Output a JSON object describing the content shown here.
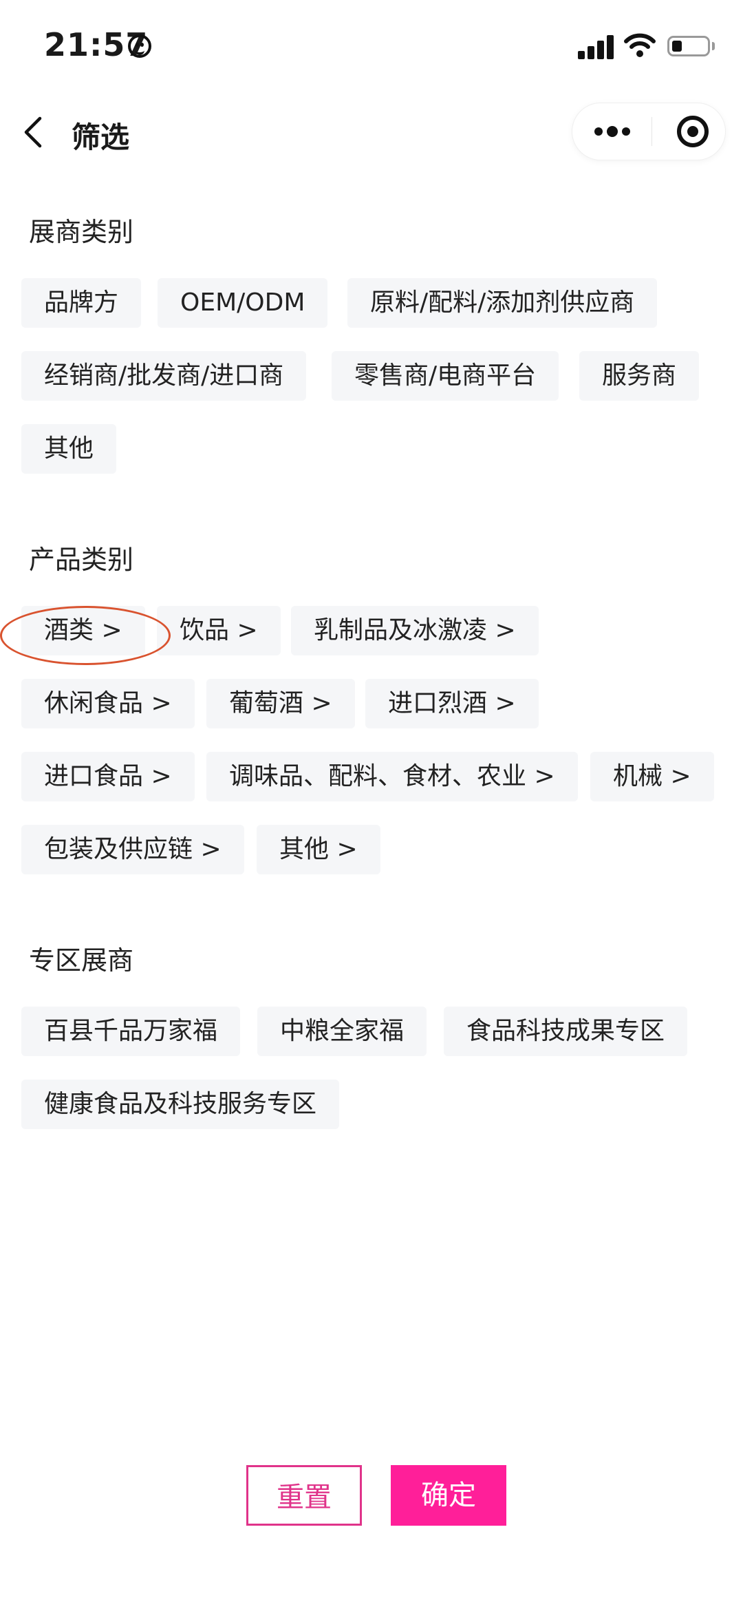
{
  "status_bar": {
    "time": "21:57"
  },
  "nav": {
    "title": "筛选"
  },
  "sections": [
    {
      "title": "展商类别",
      "tags": [
        "品牌方",
        "OEM/ODM",
        "原料/配料/添加剂供应商",
        "经销商/批发商/进口商",
        "零售商/电商平台",
        "服务商",
        "其他"
      ]
    },
    {
      "title": "产品类别",
      "tags": [
        "酒类 >",
        "饮品 >",
        "乳制品及冰激凌 >",
        "休闲食品 >",
        "葡萄酒 >",
        "进口烈酒 >",
        "进口食品 >",
        "调味品、配料、食材、农业 >",
        "机械 >",
        "包装及供应链 >",
        "其他 >"
      ]
    },
    {
      "title": "专区展商",
      "tags": [
        "百县千品万家福",
        "中粮全家福",
        "食品科技成果专区",
        "健康食品及科技服务专区"
      ]
    }
  ],
  "buttons": {
    "reset": "重置",
    "confirm": "确定"
  },
  "colors": {
    "accent": "#ff1f99",
    "tag_bg": "#f5f6f8",
    "annotation": "#d9532f"
  }
}
